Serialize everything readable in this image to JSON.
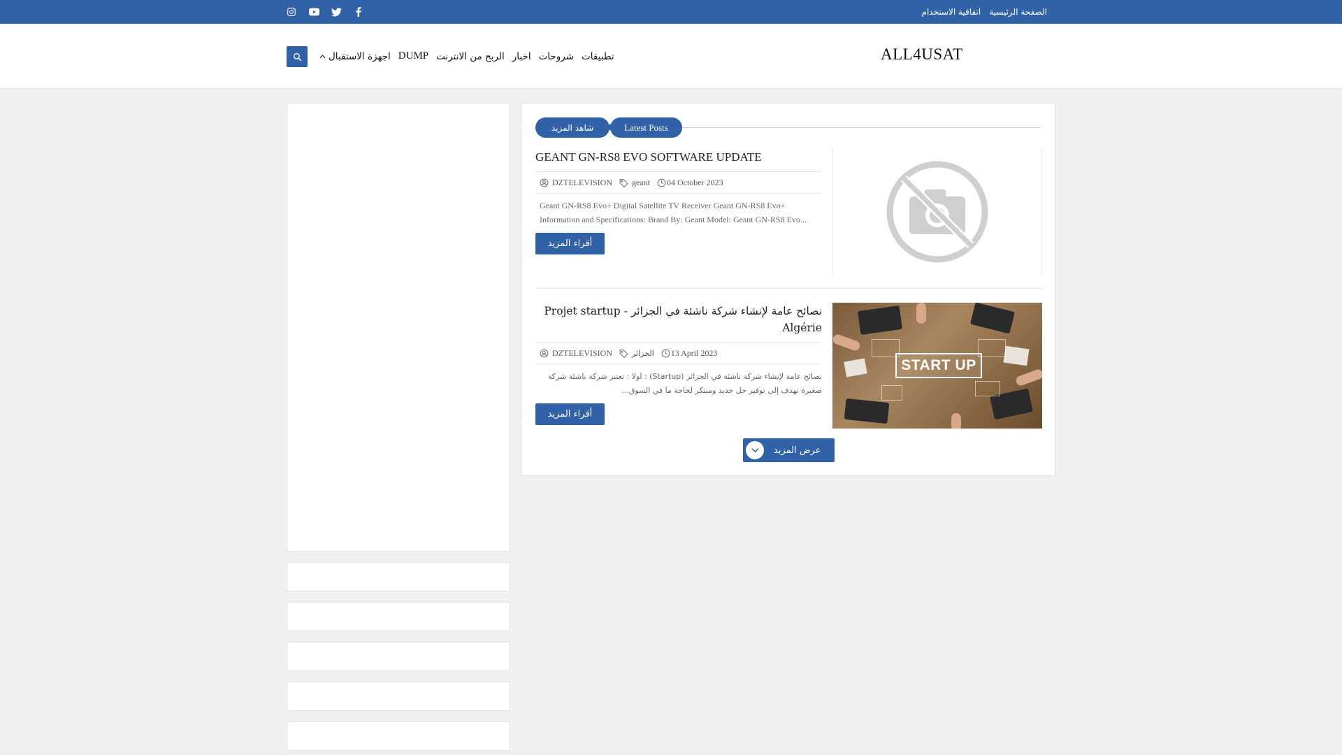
{
  "topbar": {
    "links": [
      "الصفحة الرئيسية",
      "اتفاقية الاستخدام"
    ],
    "social_icons": [
      "facebook-icon",
      "twitter-icon",
      "youtube-icon",
      "instagram-icon"
    ],
    "bg_color": "#3162a8"
  },
  "header": {
    "logo": "ALL4USAT",
    "nav": [
      "اجهزة الاستقبال",
      "DUMP",
      "الربح من الانترنت",
      "اخبار",
      "شروحات",
      "تطبيقات"
    ]
  },
  "main": {
    "see_more_label": "شاهد المزيد",
    "latest_label": "Latest Posts",
    "posts": [
      {
        "title": "GEANT GN-RS8 EVO SOFTWARE UPDATE",
        "author": "DZTELEVISION",
        "tag": "geant",
        "date": "04 October 2023",
        "excerpt": "Geant GN-RS8 Evo+ Digital Satellite TV Receiver Geant GN-RS8 Evo+ Information and Specifications: Brand By: Geant Model:  Geant GN-RS8 Evo...",
        "read_more": "أقراء المزيد",
        "image": "no-image-icon"
      },
      {
        "title": "نصائح عامة لإنشاء شركة ناشئة في الجزائر - Projet startup Algérie",
        "author": "DZTELEVISION",
        "tag": "الجزائر",
        "date": "13 April 2023",
        "excerpt": "نصائح عامة لإنشاء شركة ناشئة في الجزائر (Startup) : اولا : تعتبر شركة ناشئة شركة صغيرة تهدف إلى توفير حل جديد ومبتكر لحاجة ما في السوق...",
        "read_more": "أقراء المزيد",
        "image_text": "START UP"
      }
    ],
    "show_more": "عرض المزيد"
  },
  "colors": {
    "accent": "#3162a8",
    "background": "#f0f0f0"
  }
}
